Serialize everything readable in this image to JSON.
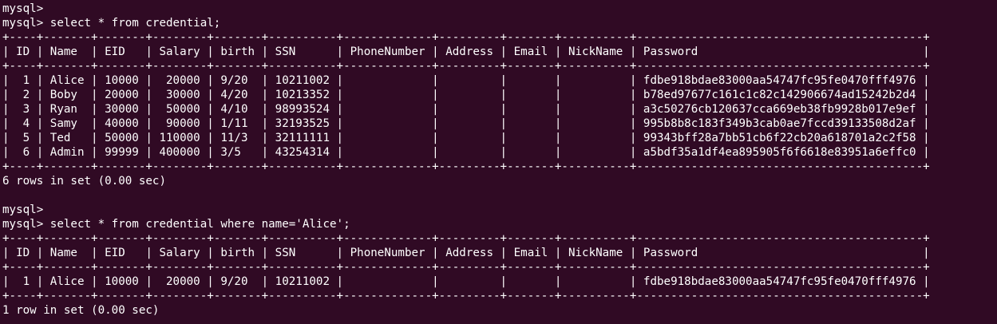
{
  "terminal": {
    "lines": [
      "mysql>",
      "mysql> select * from credential;",
      "+----+-------+-------+--------+-------+----------+-------------+---------+-------+----------+------------------------------------------+",
      "| ID | Name  | EID   | Salary | birth | SSN      | PhoneNumber | Address | Email | NickName | Password                                 |",
      "+----+-------+-------+--------+-------+----------+-------------+---------+-------+----------+------------------------------------------+",
      "|  1 | Alice | 10000 |  20000 | 9/20  | 10211002 |             |         |       |          | fdbe918bdae83000aa54747fc95fe0470fff4976 |",
      "|  2 | Boby  | 20000 |  30000 | 4/20  | 10213352 |             |         |       |          | b78ed97677c161c1c82c142906674ad15242b2d4 |",
      "|  3 | Ryan  | 30000 |  50000 | 4/10  | 98993524 |             |         |       |          | a3c50276cb120637cca669eb38fb9928b017e9ef |",
      "|  4 | Samy  | 40000 |  90000 | 1/11  | 32193525 |             |         |       |          | 995b8b8c183f349b3cab0ae7fccd39133508d2af |",
      "|  5 | Ted   | 50000 | 110000 | 11/3  | 32111111 |             |         |       |          | 99343bff28a7bb51cb6f22cb20a618701a2c2f58 |",
      "|  6 | Admin | 99999 | 400000 | 3/5   | 43254314 |             |         |       |          | a5bdf35a1df4ea895905f6f6618e83951a6effc0 |",
      "+----+-------+-------+--------+-------+----------+-------------+---------+-------+----------+------------------------------------------+",
      "6 rows in set (0.00 sec)",
      "",
      "mysql>",
      "mysql> select * from credential where name='Alice';",
      "+----+-------+-------+--------+-------+----------+-------------+---------+-------+----------+------------------------------------------+",
      "| ID | Name  | EID   | Salary | birth | SSN      | PhoneNumber | Address | Email | NickName | Password                                 |",
      "+----+-------+-------+--------+-------+----------+-------------+---------+-------+----------+------------------------------------------+",
      "|  1 | Alice | 10000 |  20000 | 9/20  | 10211002 |             |         |       |          | fdbe918bdae83000aa54747fc95fe0470fff4976 |",
      "+----+-------+-------+--------+-------+----------+-------------+---------+-------+----------+------------------------------------------+",
      "1 row in set (0.00 sec)"
    ]
  }
}
